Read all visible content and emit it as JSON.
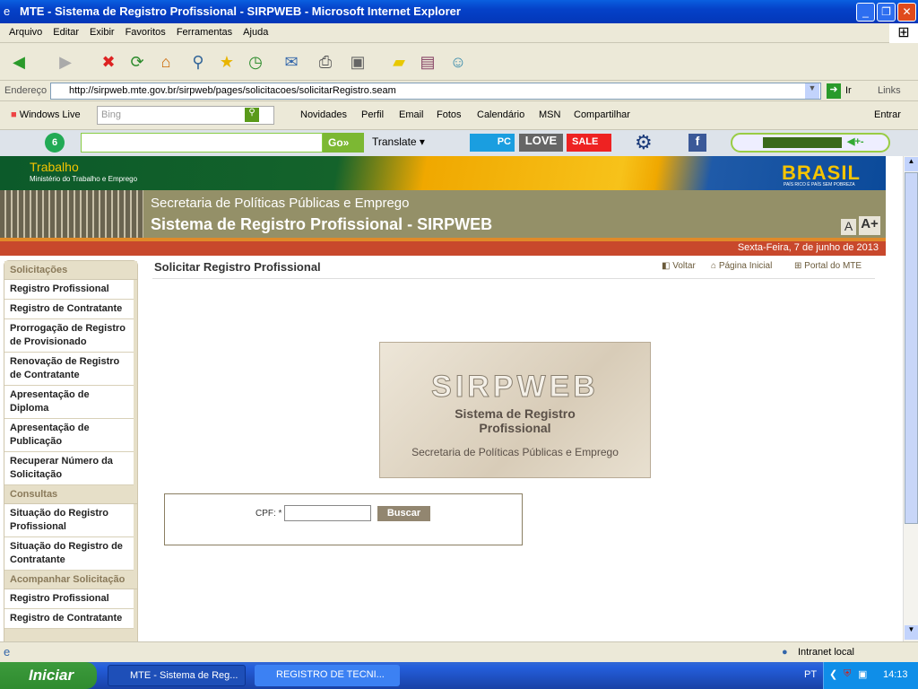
{
  "window": {
    "title": "MTE - Sistema de Registro Profissional - SIRPWEB - Microsoft Internet Explorer",
    "min": "_",
    "max": "❐",
    "close": "✕"
  },
  "menu": [
    "Arquivo",
    "Editar",
    "Exibir",
    "Favoritos",
    "Ferramentas",
    "Ajuda"
  ],
  "address": {
    "label": "Endereço",
    "url": "http://sirpweb.mte.gov.br/sirpweb/pages/solicitacoes/solicitarRegistro.seam",
    "go": "Ir",
    "links": "Links"
  },
  "live": {
    "brand": "Windows Live",
    "search_placeholder": "Bing",
    "links": [
      "Novidades",
      "Perfil",
      "Email",
      "Fotos",
      "Calendário",
      "MSN",
      "Compartilhar"
    ],
    "signin": "Entrar"
  },
  "custom": {
    "go": "Go»",
    "translate": "Translate",
    "pc": "PC",
    "love": "LOVE",
    "sale": "SALE"
  },
  "site": {
    "ministry": "Trabalho",
    "ministry_sub": "Ministério do Trabalho e Emprego",
    "brasil": "BRASIL",
    "brasil_sub": "PAÍS RICO É PAÍS SEM POBREZA",
    "secretaria": "Secretaria de Políticas Públicas e Emprego",
    "system": "Sistema de Registro Profissional - SIRPWEB",
    "font_small": "A",
    "font_large": "A+",
    "date": "Sexta-Feira, 7 de junho de 2013"
  },
  "sidebar": {
    "sections": [
      {
        "title": "Solicitações",
        "items": [
          "Registro Profissional",
          "Registro de Contratante",
          "Prorrogação de Registro de Provisionado",
          "Renovação de Registro de Contratante",
          "Apresentação de Diploma",
          "Apresentação de Publicação",
          "Recuperar Número da Solicitação"
        ]
      },
      {
        "title": "Consultas",
        "items": [
          "Situação do Registro Profissional",
          "Situação do Registro de Contratante"
        ]
      },
      {
        "title": "Acompanhar Solicitação",
        "items": [
          "Registro Profissional",
          "Registro de Contratante"
        ]
      }
    ]
  },
  "content": {
    "title": "Solicitar Registro Profissional",
    "links": [
      "Voltar",
      "Página Inicial",
      "Portal do MTE"
    ],
    "logo": {
      "name": "SIRPWEB",
      "line1": "Sistema de Registro",
      "line2": "Profissional",
      "line3": "Secretaria de Políticas Públicas e Emprego"
    },
    "form": {
      "cpf_label": "CPF: *",
      "cpf_value": "",
      "button": "Buscar"
    }
  },
  "status": {
    "zone": "Intranet local"
  },
  "taskbar": {
    "start": "Iniciar",
    "tasks": [
      "MTE - Sistema de Reg...",
      "REGISTRO DE TECNI..."
    ],
    "lang": "PT",
    "time": "14:13"
  }
}
